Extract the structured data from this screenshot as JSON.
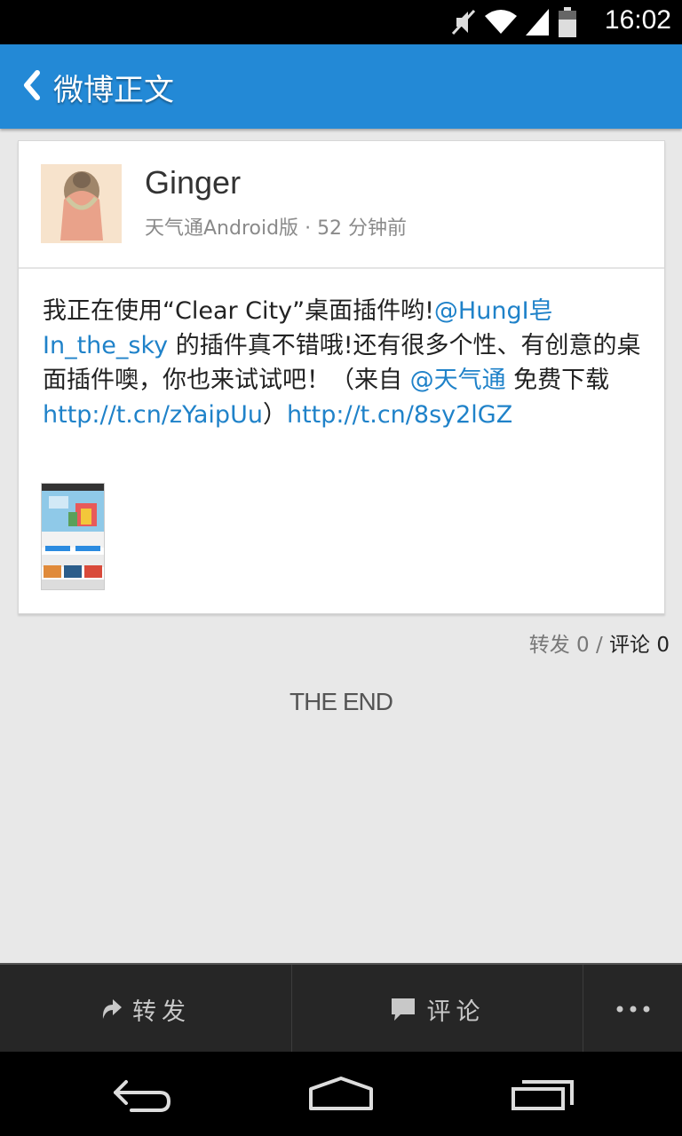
{
  "status_bar": {
    "time": "16:02",
    "icons": [
      "mute-icon",
      "wifi-icon",
      "signal-icon",
      "battery-icon"
    ]
  },
  "app_bar": {
    "back_icon": "chevron-left-icon",
    "title": "微博正文"
  },
  "post": {
    "author": "Ginger",
    "source": "天气通Android版",
    "time_ago": "52 分钟前",
    "text_parts": [
      "我正在使用“Clear City”桌面插件哟!",
      "@HungI皂In_the_sky",
      " 的插件真不错哦!还有很多个性、有创意的桌面插件噢，你也来试试吧！（来自 ",
      "@天气通",
      " 免费下载",
      "http://t.cn/zYaipUu",
      "）",
      "http://t.cn/8sy2lGZ"
    ],
    "image": "post-image-thumbnail"
  },
  "stats": {
    "repost_label": "转发",
    "repost_count": "0",
    "separator": "/",
    "comment_label": "评论",
    "comment_count": "0"
  },
  "footer_text": "THE END",
  "toolbar": {
    "repost": "转发",
    "comment": "评论",
    "more_icon": "more-icon"
  },
  "nav_bar": {
    "icons": [
      "back-icon",
      "home-icon",
      "recents-icon"
    ]
  },
  "colors": {
    "app_bar": "#2389d6",
    "link": "#1f82c9",
    "background": "#e8e8e8",
    "toolbar": "#262626"
  }
}
